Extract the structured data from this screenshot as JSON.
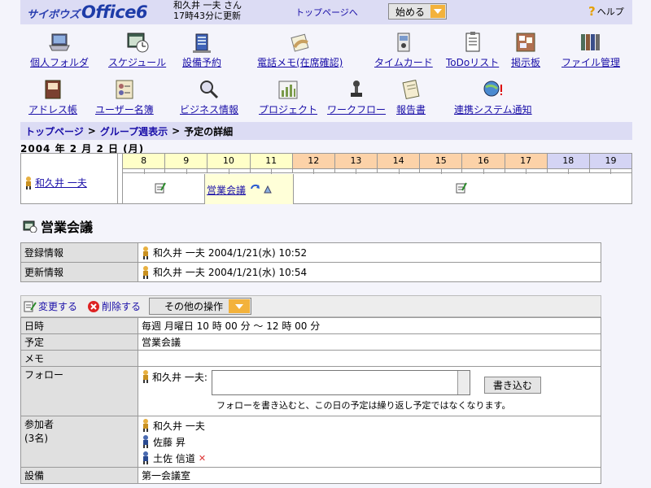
{
  "header": {
    "brand_small": "サイボウズ",
    "brand_large": "Office6",
    "user_name": "和久井 一夫 さん",
    "updated": "17時43分に更新",
    "top_link": "トップページへ",
    "start_label": "始める",
    "help_label": "ヘルプ"
  },
  "apps": [
    {
      "label": "個人フォルダ",
      "icon": "laptop-icon"
    },
    {
      "label": "スケジュール",
      "icon": "calendar-clock-icon"
    },
    {
      "label": "設備予約",
      "icon": "building-icon"
    },
    {
      "label": "電話メモ(在席確認)",
      "icon": "phone-memo-icon"
    },
    {
      "label": "タイムカード",
      "icon": "timecard-icon"
    },
    {
      "label": "ToDoリスト",
      "icon": "todo-icon"
    },
    {
      "label": "掲示板",
      "icon": "bulletin-board-icon"
    },
    {
      "label": "ファイル管理",
      "icon": "file-binder-icon"
    },
    {
      "label": "アドレス帳",
      "icon": "address-book-icon"
    },
    {
      "label": "ユーザー名簿",
      "icon": "user-roster-icon"
    },
    {
      "label": "ビジネス情報",
      "icon": "magnifier-icon"
    },
    {
      "label": "プロジェクト",
      "icon": "bar-chart-icon"
    },
    {
      "label": "ワークフロー",
      "icon": "stamp-icon"
    },
    {
      "label": "報告書",
      "icon": "report-icon"
    },
    {
      "label": "連携システム通知",
      "icon": "globe-alert-icon"
    }
  ],
  "breadcrumb": {
    "items": [
      "トップページ",
      "グループ週表示"
    ],
    "separator": ">",
    "current": "予定の詳細"
  },
  "date_label": "2004 年 2 月 2 日 (月)",
  "timeline": {
    "hours": [
      "8",
      "9",
      "10",
      "11",
      "12",
      "13",
      "14",
      "15",
      "16",
      "17",
      "18",
      "19"
    ],
    "hour_colors": [
      "#ffffc8",
      "#ffffc8",
      "#ffffc8",
      "#ffffc8",
      "#fcd2a8",
      "#fcd2a8",
      "#fcd2a8",
      "#fcd2a8",
      "#fcd2a8",
      "#fcd2a8",
      "#d4d4f4",
      "#d4d4f4"
    ],
    "member": "和久井 一夫",
    "event": "営業会議"
  },
  "event": {
    "title": "営業会議",
    "registered_label": "登録情報",
    "registered_user": "和久井 一夫",
    "registered_time": "2004/1/21(水) 10:52",
    "updated_label": "更新情報",
    "updated_user": "和久井 一夫",
    "updated_time": "2004/1/21(水) 10:54"
  },
  "actions": {
    "edit": "変更する",
    "delete": "削除する",
    "other": "その他の操作"
  },
  "detail": {
    "datetime_label": "日時",
    "datetime_value": "毎週 月曜日 10 時 00 分 ～ 12 時 00 分",
    "plan_label": "予定",
    "plan_value": "営業会議",
    "memo_label": "メモ",
    "memo_value": "",
    "follow_label": "フォロー",
    "follow_user": "和久井 一夫:",
    "follow_placeholder": "",
    "write_button": "書き込む",
    "follow_note": "フォローを書き込むと、この日の予定は繰り返し予定ではなくなります。",
    "participants_label": "参加者",
    "participants_count": "(3名)",
    "participants": [
      "和久井 一夫",
      "佐藤 昇",
      "土佐 信道"
    ],
    "facility_label": "設備",
    "facility_value": "第一会議室"
  },
  "colors": {
    "header_bg": "#dcdcf4",
    "link": "#1a0fa8",
    "accent": "#f3b23c"
  }
}
